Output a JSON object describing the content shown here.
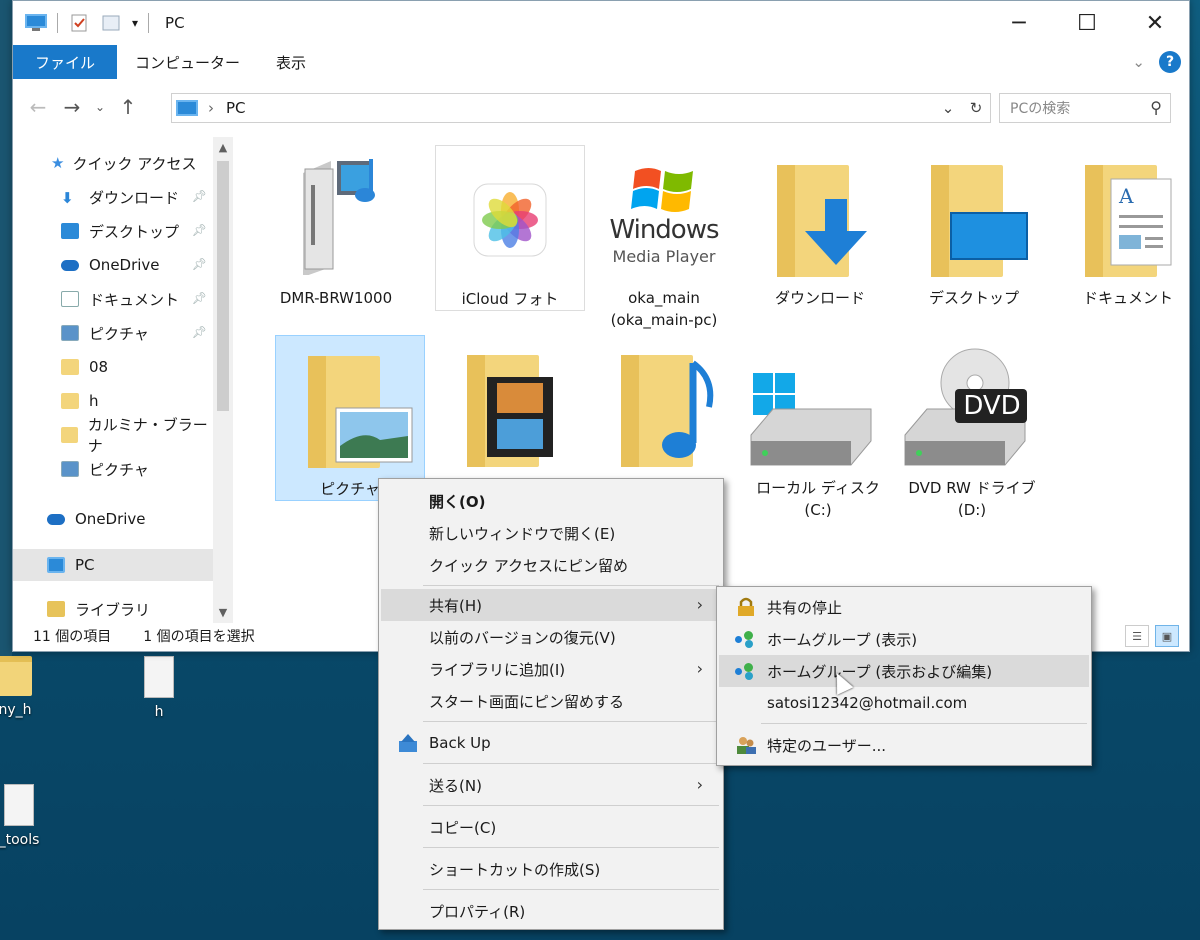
{
  "window": {
    "title": "PC",
    "controls": {
      "minimize": "─",
      "maximize": "☐",
      "close": "✕"
    }
  },
  "ribbon": {
    "tabs": [
      "ファイル",
      "コンピューター",
      "表示"
    ],
    "help": "?"
  },
  "address": {
    "path": "PC",
    "search_placeholder": "PCの検索"
  },
  "sidebar": {
    "items": [
      {
        "label": "クイック アクセス",
        "icon": "star-icon"
      },
      {
        "label": "ダウンロード",
        "icon": "download-icon",
        "pinned": true
      },
      {
        "label": "デスクトップ",
        "icon": "desktop-icon",
        "pinned": true
      },
      {
        "label": "OneDrive",
        "icon": "cloud-icon",
        "pinned": true
      },
      {
        "label": "ドキュメント",
        "icon": "document-icon",
        "pinned": true
      },
      {
        "label": "ピクチャ",
        "icon": "pictures-icon",
        "pinned": true
      },
      {
        "label": "08",
        "icon": "folder-icon"
      },
      {
        "label": "h",
        "icon": "folder-icon"
      },
      {
        "label": "カルミナ・ブラーナ",
        "icon": "folder-icon"
      },
      {
        "label": "ピクチャ",
        "icon": "pictures-icon"
      },
      {
        "label": "OneDrive",
        "icon": "cloud-icon"
      },
      {
        "label": "PC",
        "icon": "pc-icon",
        "selected": true
      },
      {
        "label": "ライブラリ",
        "icon": "library-icon"
      }
    ]
  },
  "items": [
    {
      "label": "DMR-BRW1000",
      "icon": "media-server-icon"
    },
    {
      "label": "iCloud フォト",
      "icon": "icloud-photos-icon"
    },
    {
      "label": "oka_main\n(oka_main-pc)",
      "line1": "oka_main",
      "line2": "(oka_main-pc)",
      "icon": "windows-media-player-icon",
      "logo_line1": "Windows",
      "logo_line2": "Media Player"
    },
    {
      "label": "ダウンロード",
      "icon": "downloads-folder-icon"
    },
    {
      "label": "デスクトップ",
      "icon": "desktop-folder-icon"
    },
    {
      "label": "ドキュメント",
      "icon": "documents-folder-icon"
    },
    {
      "label": "ピクチャ",
      "icon": "pictures-folder-icon",
      "selected": true
    },
    {
      "label": "",
      "icon": "videos-folder-icon"
    },
    {
      "label": "",
      "icon": "music-folder-icon"
    },
    {
      "label": "ローカル ディスク (C:)",
      "icon": "local-disk-icon"
    },
    {
      "label": "DVD RW ドライブ\n(D:)",
      "line1": "DVD RW ドライブ",
      "line2": "(D:)",
      "icon": "dvd-drive-icon",
      "badge": "DVD"
    }
  ],
  "status": {
    "count": "11 個の項目",
    "selection": "1 個の項目を選択"
  },
  "context_menu": {
    "items": [
      {
        "label": "開く(O)",
        "bold": true
      },
      {
        "label": "新しいウィンドウで開く(E)"
      },
      {
        "label": "クイック アクセスにピン留め"
      },
      {
        "label": "共有(H)",
        "submenu": true,
        "highlighted": true
      },
      {
        "label": "以前のバージョンの復元(V)"
      },
      {
        "label": "ライブラリに追加(I)",
        "submenu": true
      },
      {
        "label": "スタート画面にピン留めする"
      },
      {
        "label": "Back Up",
        "icon": "backup-icon"
      },
      {
        "label": "送る(N)",
        "submenu": true
      },
      {
        "label": "コピー(C)"
      },
      {
        "label": "ショートカットの作成(S)"
      },
      {
        "label": "プロパティ(R)"
      }
    ]
  },
  "share_submenu": {
    "items": [
      {
        "label": "共有の停止",
        "icon": "lock-icon"
      },
      {
        "label": "ホームグループ (表示)",
        "icon": "homegroup-icon"
      },
      {
        "label": "ホームグループ (表示および編集)",
        "icon": "homegroup-icon",
        "highlighted": true
      },
      {
        "label": "satosi12342@hotmail.com"
      },
      {
        "label": "特定のユーザー...",
        "icon": "users-icon"
      }
    ]
  },
  "desktop": {
    "icons": [
      "ny_h",
      "h",
      "_tools"
    ]
  },
  "colors": {
    "accent": "#1979ca",
    "selection": "#cce8ff",
    "folder": "#f3d57c"
  }
}
